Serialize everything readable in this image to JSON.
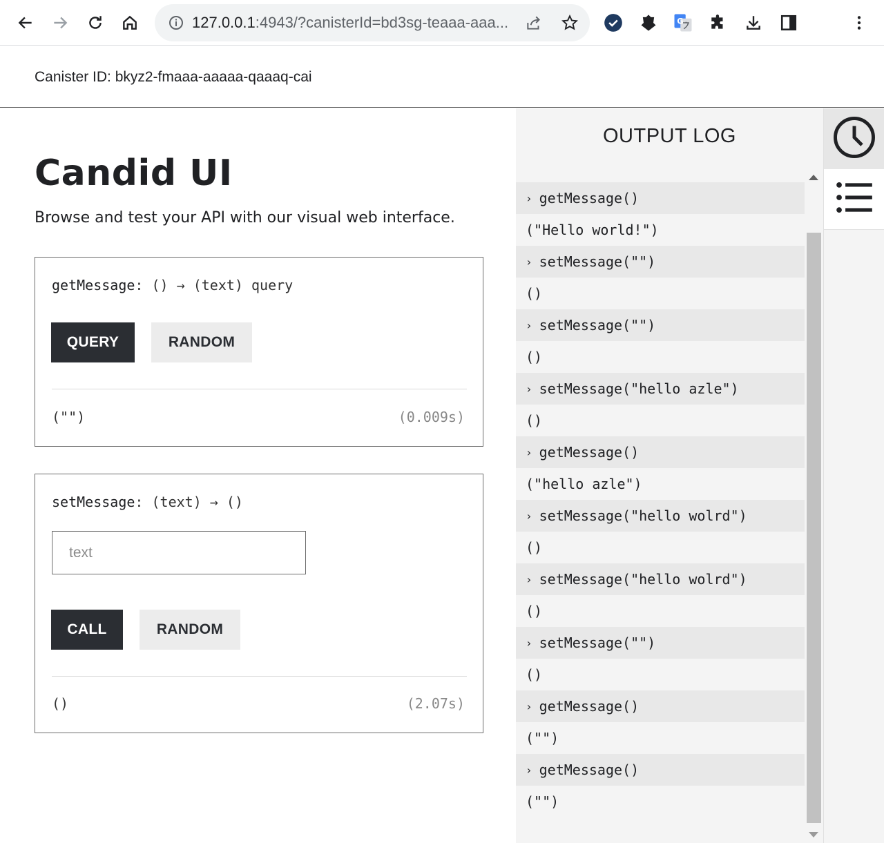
{
  "browser": {
    "url_host": "127.0.0.1",
    "url_rest": ":4943/?canisterId=bd3sg-teaaa-aaa...",
    "icons": [
      "back-arrow-icon",
      "forward-arrow-icon",
      "reload-icon",
      "home-icon",
      "info-icon",
      "share-icon",
      "star-icon",
      "checkmark-shield-icon",
      "pocket-icon",
      "translate-icon",
      "extensions-puzzle-icon",
      "download-icon",
      "side-panel-icon",
      "kebab-menu-icon"
    ]
  },
  "canister": {
    "label": "Canister ID: bkyz2-fmaaa-aaaaa-qaaaq-cai"
  },
  "page": {
    "title": "Candid UI",
    "subtitle": "Browse and test your API with our visual web interface."
  },
  "methods": [
    {
      "name": "getMessage",
      "signature": ": () → (text) query",
      "primary_button": "QUERY",
      "random_button": "RANDOM",
      "result": "(\"\")",
      "timing": "(0.009s)"
    },
    {
      "name": "setMessage",
      "signature": ": (text) → ()",
      "input_placeholder": "text",
      "input_value": "",
      "primary_button": "CALL",
      "random_button": "RANDOM",
      "result": "()",
      "timing": "(2.07s)"
    }
  ],
  "output_log": {
    "title": "OUTPUT LOG",
    "entries": [
      {
        "kind": "call",
        "text": "getMessage()"
      },
      {
        "kind": "result",
        "text": "(\"Hello world!\")"
      },
      {
        "kind": "call",
        "text": "setMessage(\"\")"
      },
      {
        "kind": "result",
        "text": "()"
      },
      {
        "kind": "call",
        "text": "setMessage(\"\")"
      },
      {
        "kind": "result",
        "text": "()"
      },
      {
        "kind": "call",
        "text": "setMessage(\"hello azle\")"
      },
      {
        "kind": "result",
        "text": "()"
      },
      {
        "kind": "call",
        "text": "getMessage()"
      },
      {
        "kind": "result",
        "text": "(\"hello azle\")"
      },
      {
        "kind": "call",
        "text": "setMessage(\"hello wolrd\")"
      },
      {
        "kind": "result",
        "text": "()"
      },
      {
        "kind": "call",
        "text": "setMessage(\"hello wolrd\")"
      },
      {
        "kind": "result",
        "text": "()"
      },
      {
        "kind": "call",
        "text": "setMessage(\"\")"
      },
      {
        "kind": "result",
        "text": "()"
      },
      {
        "kind": "call",
        "text": "getMessage()"
      },
      {
        "kind": "result",
        "text": "(\"\")"
      },
      {
        "kind": "call",
        "text": "getMessage()"
      },
      {
        "kind": "result",
        "text": "(\"\")"
      }
    ],
    "caret": "›"
  },
  "rail": {
    "icons": [
      "clock-icon",
      "list-icon"
    ]
  }
}
